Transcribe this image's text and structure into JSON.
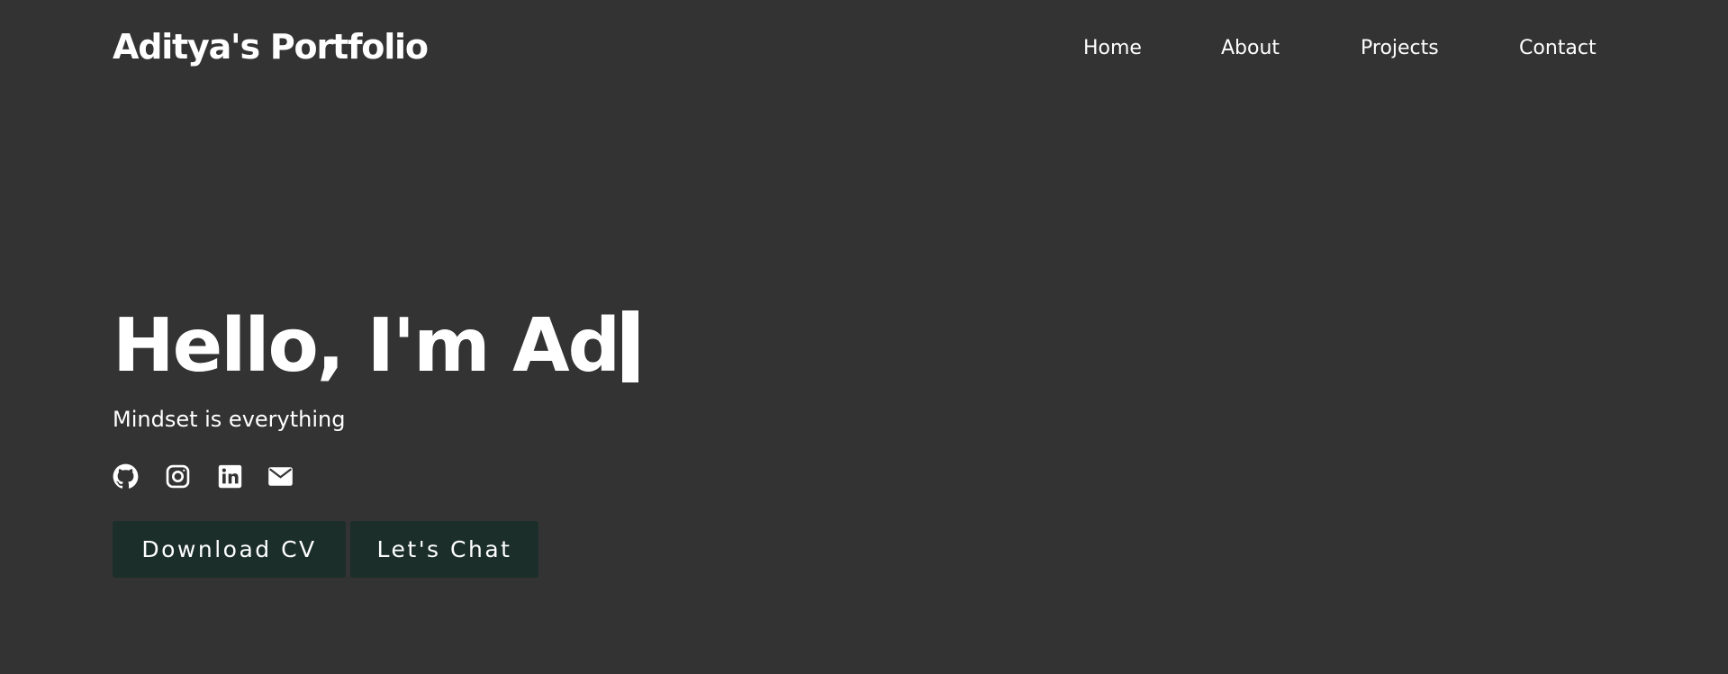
{
  "header": {
    "logo": "Aditya's Portfolio",
    "nav": [
      {
        "label": "Home"
      },
      {
        "label": "About"
      },
      {
        "label": "Projects"
      },
      {
        "label": "Contact"
      }
    ]
  },
  "hero": {
    "title": "Hello, I'm Ad",
    "tagline": "Mindset is everything",
    "socials": [
      {
        "icon": "github-icon"
      },
      {
        "icon": "instagram-icon"
      },
      {
        "icon": "linkedin-icon"
      },
      {
        "icon": "email-icon"
      }
    ],
    "buttons": {
      "download_cv": "Download CV",
      "lets_chat": "Let's Chat"
    }
  },
  "colors": {
    "background": "#333333",
    "text": "#ffffff",
    "button_bg": "#1b2e2a"
  }
}
